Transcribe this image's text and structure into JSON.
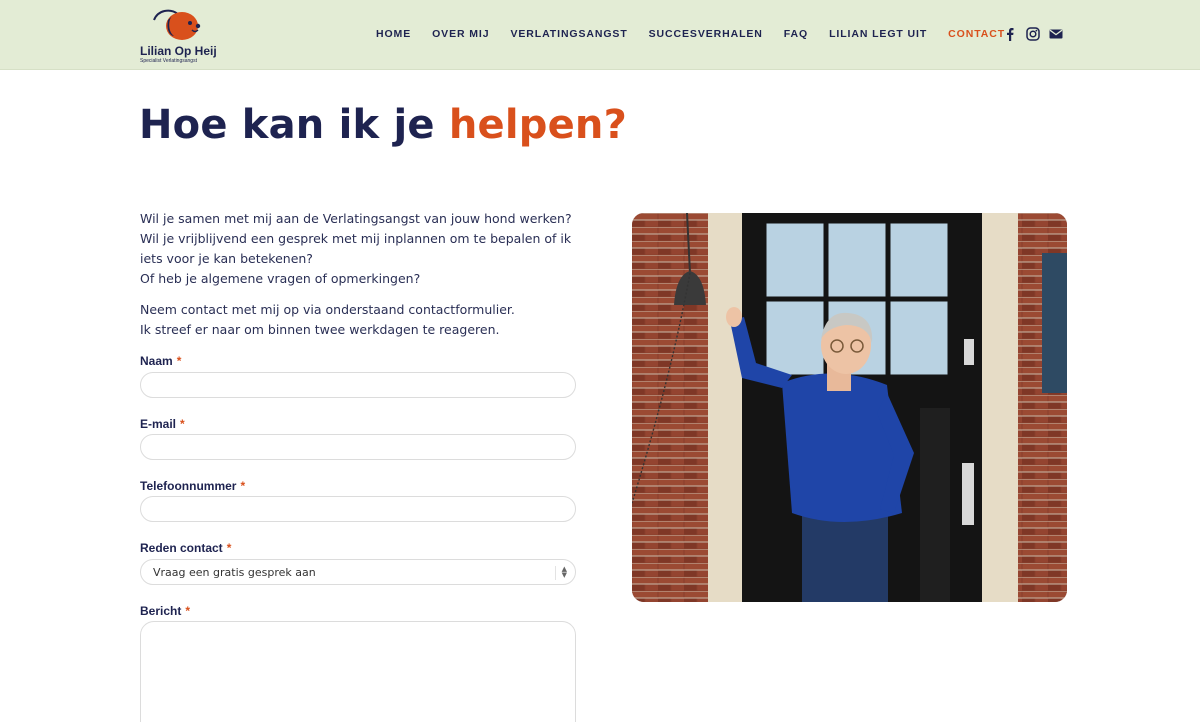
{
  "brand": {
    "name": "Lilian Op Heij",
    "tagline": "Specialist Verlatingsangst",
    "accent_color": "#d9501c",
    "navy_color": "#1e2350",
    "header_bg": "#e3ecd5"
  },
  "nav": {
    "items": [
      {
        "label": "HOME"
      },
      {
        "label": "OVER MIJ"
      },
      {
        "label": "VERLATINGSANGST"
      },
      {
        "label": "SUCCESVERHALEN"
      },
      {
        "label": "FAQ"
      },
      {
        "label": "LILIAN LEGT UIT"
      },
      {
        "label": "CONTACT",
        "active": true
      }
    ],
    "social_icons": [
      "facebook-icon",
      "instagram-icon",
      "mail-icon"
    ]
  },
  "hero": {
    "title_main": "Hoe kan ik je",
    "title_accent": "helpen?"
  },
  "intro": {
    "paragraph1": [
      "Wil je samen met mij aan de Verlatingsangst van jouw hond werken?",
      "Wil je vrijblijvend een gesprek met mij inplannen om te bepalen of ik",
      "iets voor je kan betekenen?",
      "Of heb je algemene vragen of opmerkingen?"
    ],
    "paragraph2": [
      "Neem contact met mij op via onderstaand contactformulier.",
      "Ik streef er naar om binnen twee werkdagen te reageren."
    ]
  },
  "form": {
    "required_mark": "*",
    "name_label": "Naam",
    "email_label": "E-mail",
    "phone_label": "Telefoonnummer",
    "reason_label": "Reden contact",
    "reason_value": "Vraag een gratis gesprek aan",
    "message_label": "Bericht"
  }
}
